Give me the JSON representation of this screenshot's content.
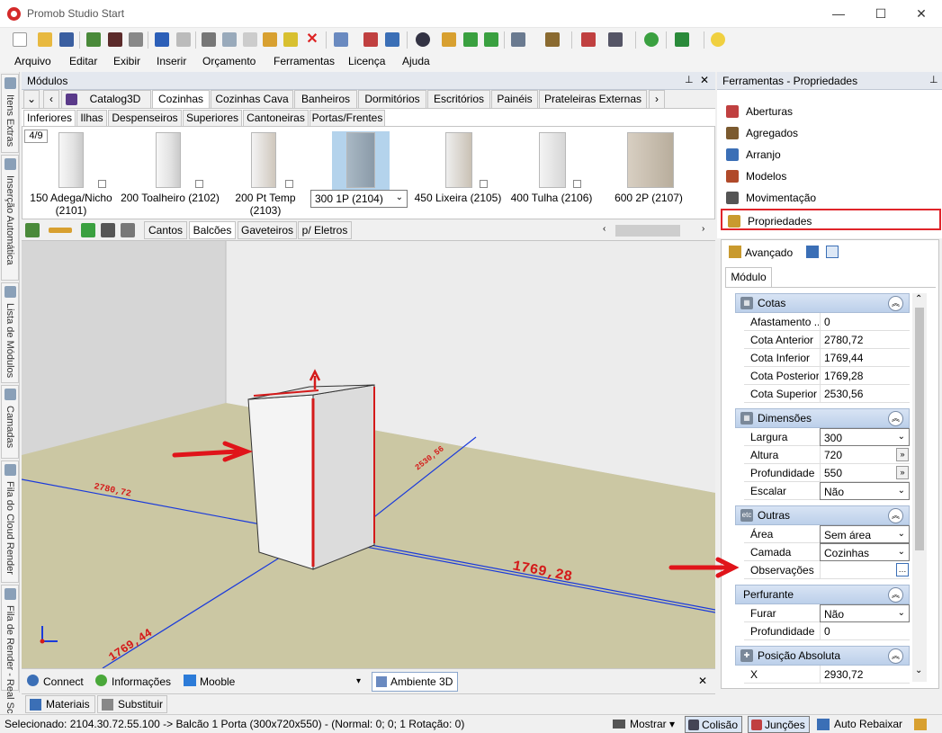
{
  "window": {
    "title": "Promob Studio Start",
    "minimize": "—",
    "maximize": "☐",
    "close": "✕"
  },
  "menu": [
    "Arquivo",
    "Editar",
    "Exibir",
    "Inserir",
    "Orçamento",
    "Ferramentas",
    "Licença",
    "Ajuda"
  ],
  "left_dock": {
    "tabs": [
      "Itens Extras",
      "Inserção Automática",
      "Lista de Módulos",
      "Camadas",
      "Fila do Cloud Render",
      "Fila de Render - Real Sc"
    ]
  },
  "modules_panel": {
    "title": "Módulos",
    "pin": "📌",
    "close": "✕",
    "catalog_tabs": [
      "Catalog3D",
      "Cozinhas",
      "Cozinhas Cava",
      "Banheiros",
      "Dormitórios",
      "Escritórios",
      "Painéis",
      "Prateleiras Externas"
    ],
    "catalog_selected": "Cozinhas",
    "sub_tabs": [
      "Inferiores",
      "Ilhas",
      "Despenseiros",
      "Superiores",
      "Cantoneiras",
      "Portas/Frentes"
    ],
    "sub_selected": "Inferiores",
    "pager": "4/9",
    "items": [
      {
        "label": "150 Adega/Nicho (2101)"
      },
      {
        "label": "200 Toalheiro (2102)"
      },
      {
        "label": "200 Pt Temp (2103)"
      },
      {
        "label": "300 1P (2104)"
      },
      {
        "label": "450 Lixeira (2105)"
      },
      {
        "label": "400 Tulha (2106)"
      },
      {
        "label": "600 2P (2107)"
      }
    ],
    "selected_item": "300 1P (2104)",
    "tool_tabs": [
      "Cantos",
      "Balcões",
      "Gaveteiros",
      "p/ Eletros"
    ],
    "tool_tab_selected": "Balcões"
  },
  "viewport": {
    "dimensions": [
      "1769,28",
      "2780,72",
      "2530,56",
      "1769,44"
    ]
  },
  "bottom_tabs": {
    "left": [
      "Connect",
      "Informações",
      "Mooble"
    ],
    "active_view": "Ambiente 3D",
    "row2": [
      "Materiais",
      "Substituir"
    ]
  },
  "tools_panel": {
    "title": "Ferramentas - Propriedades",
    "items": [
      {
        "label": "Aberturas",
        "color": "#c04040"
      },
      {
        "label": "Agregados",
        "color": "#7b5a2f"
      },
      {
        "label": "Arranjo",
        "color": "#3b6fb6"
      },
      {
        "label": "Modelos",
        "color": "#b04a2a"
      },
      {
        "label": "Movimentação",
        "color": "#555555"
      },
      {
        "label": "Propriedades",
        "color": "#c99a2e"
      }
    ],
    "highlighted": "Propriedades",
    "highlight_color": "#e0242a"
  },
  "properties": {
    "advanced_label": "Avançado",
    "tab": "Módulo",
    "sections": {
      "cotas": {
        "title": "Cotas",
        "rows": [
          {
            "k": "Afastamento ...",
            "v": "0"
          },
          {
            "k": "Cota Anterior",
            "v": "2780,72"
          },
          {
            "k": "Cota Inferior",
            "v": "1769,44"
          },
          {
            "k": "Cota Posterior",
            "v": "1769,28"
          },
          {
            "k": "Cota Superior",
            "v": "2530,56"
          }
        ]
      },
      "dimensoes": {
        "title": "Dimensões",
        "rows": [
          {
            "k": "Largura",
            "v": "300"
          },
          {
            "k": "Altura",
            "v": "720"
          },
          {
            "k": "Profundidade",
            "v": "550"
          },
          {
            "k": "Escalar",
            "v": "Não"
          }
        ]
      },
      "outras": {
        "title": "Outras",
        "icon_text": "etc",
        "rows": [
          {
            "k": "Área",
            "v": "Sem área"
          },
          {
            "k": "Camada",
            "v": "Cozinhas"
          },
          {
            "k": "Observações",
            "v": ""
          }
        ]
      },
      "perfurante": {
        "title": "Perfurante",
        "rows": [
          {
            "k": "Furar",
            "v": "Não"
          },
          {
            "k": "Profundidade",
            "v": "0"
          }
        ]
      },
      "posicao": {
        "title": "Posição Absoluta",
        "rows": [
          {
            "k": "X",
            "v": "2930,72"
          }
        ]
      }
    }
  },
  "status": {
    "selection": "Selecionado: 2104.30.72.55.100 -> Balcão 1 Porta (300x720x550) - (Normal: 0; 0; 1 Rotação: 0)",
    "mostrar": "Mostrar",
    "colisao": "Colisão",
    "juncoes": "Junções",
    "auto_rebaixar": "Auto Rebaixar"
  }
}
